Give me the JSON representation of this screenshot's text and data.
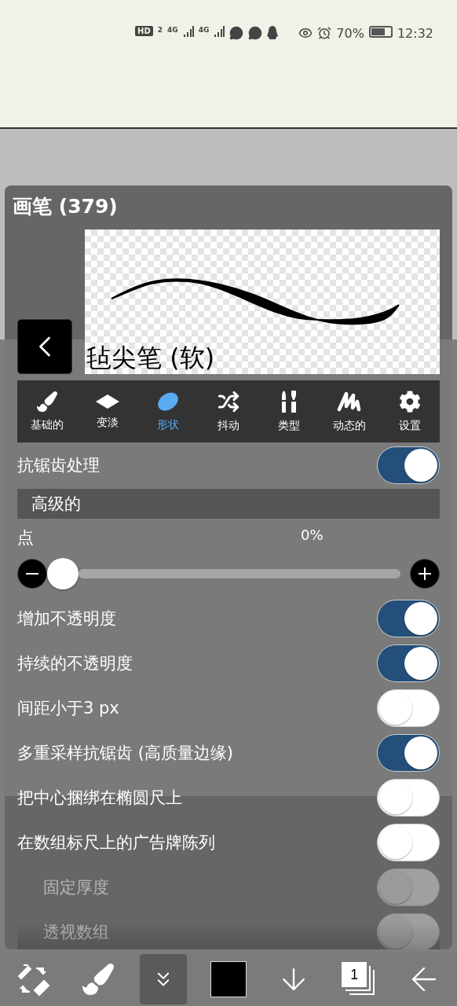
{
  "status_bar": {
    "indicators": [
      "HD",
      "2",
      "4G",
      "4G"
    ],
    "battery": "70%",
    "time": "12:32"
  },
  "panel": {
    "title": "画笔 (379)",
    "brush_name": "毡尖笔 (软)",
    "tabs": [
      {
        "kind": "brush",
        "label": "基础的",
        "selected": false
      },
      {
        "kind": "fade",
        "label": "变淡",
        "selected": false
      },
      {
        "kind": "shape",
        "label": "形状",
        "selected": true
      },
      {
        "kind": "jitter",
        "label": "抖动",
        "selected": false
      },
      {
        "kind": "type",
        "label": "类型",
        "selected": false
      },
      {
        "kind": "dynamic",
        "label": "动态的",
        "selected": false
      },
      {
        "kind": "settings",
        "label": "设置",
        "selected": false
      }
    ],
    "settings": [
      {
        "kind": "toggle",
        "label": "抗锯齿处理",
        "on": true,
        "disabled": false
      },
      {
        "kind": "section",
        "label": "高级的"
      },
      {
        "kind": "slider",
        "label": "点",
        "value": "0%",
        "level": 0
      },
      {
        "kind": "toggle",
        "label": "增加不透明度",
        "on": true,
        "disabled": false
      },
      {
        "kind": "toggle",
        "label": "持续的不透明度",
        "on": true,
        "disabled": false
      },
      {
        "kind": "toggle",
        "label": "间距小于3 px",
        "on": false,
        "disabled": false
      },
      {
        "kind": "toggle",
        "label": "多重采样抗锯齿 (高质量边缘)",
        "on": true,
        "disabled": false
      },
      {
        "kind": "toggle",
        "label": "把中心捆绑在椭圆尺上",
        "on": false,
        "disabled": false
      },
      {
        "kind": "toggle",
        "label": "在数组标尺上的广告牌陈列",
        "on": false,
        "disabled": false
      },
      {
        "kind": "toggle",
        "label": "固定厚度",
        "on": false,
        "disabled": true,
        "indented": true
      },
      {
        "kind": "toggle",
        "label": "透视数组",
        "on": false,
        "disabled": true,
        "indented": true
      }
    ]
  },
  "bottom_toolbar": {
    "layer_count": "1",
    "tools": [
      {
        "kind": "swap",
        "selected": false
      },
      {
        "kind": "brush",
        "selected": false
      },
      {
        "kind": "expand",
        "selected": true
      },
      {
        "kind": "color",
        "selected": false
      },
      {
        "kind": "down",
        "selected": false
      },
      {
        "kind": "layers",
        "selected": false
      },
      {
        "kind": "back",
        "selected": false
      }
    ]
  }
}
